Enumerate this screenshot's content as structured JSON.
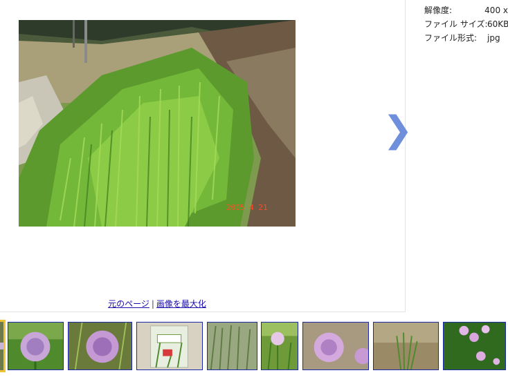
{
  "viewer": {
    "next_arrow": "❯",
    "links": {
      "original_page": "元のページ",
      "separator": "|",
      "maximize": "画像を最大化"
    }
  },
  "details": {
    "rows": [
      {
        "label": "解像度:",
        "value": "400 x"
      },
      {
        "label": "ファイル サイズ:",
        "value": "60KB"
      },
      {
        "label": "ファイル形式:",
        "value": "jpg"
      }
    ]
  },
  "photo": {
    "date_stamp": "2005 4 21"
  },
  "colors": {
    "arrow": "#6f8fdc",
    "link": "#1a0dab",
    "thumb_border": "#1a27a8",
    "selected_thumb_border": "#f1c232"
  },
  "thumbnails": [
    {
      "subject": "selected-partial"
    },
    {
      "subject": "chive-flower"
    },
    {
      "subject": "chive-flower-closeup"
    },
    {
      "subject": "packaged-chives"
    },
    {
      "subject": "chive-grass"
    },
    {
      "subject": "chive-flower-small"
    },
    {
      "subject": "chive-flower-pink"
    },
    {
      "subject": "chive-clump"
    },
    {
      "subject": "chive-flowers-group"
    }
  ]
}
